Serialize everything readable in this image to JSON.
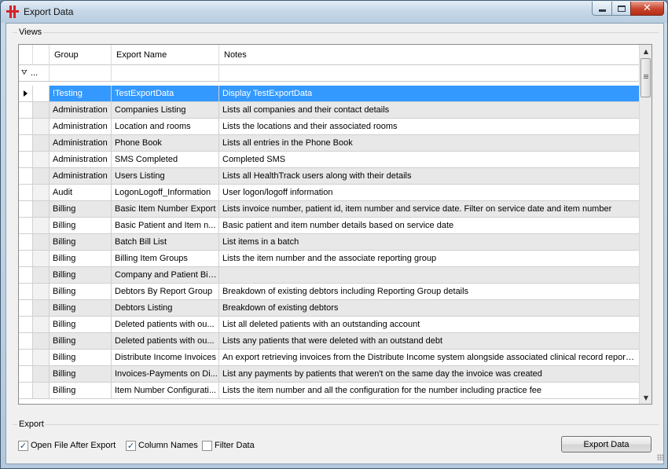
{
  "window": {
    "title": "Export Data",
    "close_glyph": "✕"
  },
  "views": {
    "label": "Views",
    "columns": {
      "group": "Group",
      "name": "Export Name",
      "notes": "Notes"
    },
    "filter_dots": "...",
    "filter_icon_glyph": "⛛",
    "scroll_up": "▲",
    "scroll_down": "▼",
    "rows": [
      {
        "group": "!Testing",
        "name": "TestExportData",
        "notes": "Display TestExportData",
        "selected": true
      },
      {
        "group": "Administration",
        "name": "Companies Listing",
        "notes": "Lists all companies and their contact details"
      },
      {
        "group": "Administration",
        "name": "Location and rooms",
        "notes": "Lists the locations and their associated rooms"
      },
      {
        "group": "Administration",
        "name": "Phone Book",
        "notes": "Lists all entries in the Phone Book"
      },
      {
        "group": "Administration",
        "name": "SMS Completed",
        "notes": "Completed SMS"
      },
      {
        "group": "Administration",
        "name": "Users Listing",
        "notes": "Lists all HealthTrack users along with their details"
      },
      {
        "group": "Audit",
        "name": "LogonLogoff_Information",
        "notes": "User logon/logoff information"
      },
      {
        "group": "Billing",
        "name": "Basic Item Number Export",
        "notes": "Lists invoice number, patient id, item number and service date. Filter on service date and item number"
      },
      {
        "group": "Billing",
        "name": "Basic Patient and Item n...",
        "notes": "Basic patient and item number details based on service date"
      },
      {
        "group": "Billing",
        "name": "Batch Bill List",
        "notes": "List items in a batch"
      },
      {
        "group": "Billing",
        "name": "Billing Item Groups",
        "notes": "Lists the item number and the associate reporting group"
      },
      {
        "group": "Billing",
        "name": "Company and Patient Billi...",
        "notes": ""
      },
      {
        "group": "Billing",
        "name": "Debtors By Report Group",
        "notes": "Breakdown of existing debtors including Reporting Group details"
      },
      {
        "group": "Billing",
        "name": "Debtors Listing",
        "notes": "Breakdown of existing debtors"
      },
      {
        "group": "Billing",
        "name": "Deleted patients with ou...",
        "notes": "List all deleted patients with an outstanding account"
      },
      {
        "group": "Billing",
        "name": "Deleted patients with ou...",
        "notes": "Lists any patients that were deleted with an outstand debt"
      },
      {
        "group": "Billing",
        "name": "Distribute Income Invoices",
        "notes": "An export retrieving invoices from the Distribute Income system alongside associated clinical record reporti..."
      },
      {
        "group": "Billing",
        "name": "Invoices-Payments on Di...",
        "notes": "List any payments by patients that weren't on the same day the invoice was created"
      },
      {
        "group": "Billing",
        "name": "Item Number Configurati...",
        "notes": "Lists the item number and all the configuration for the number including practice fee"
      }
    ]
  },
  "export": {
    "label": "Export",
    "check_glyph": "✓",
    "options": [
      {
        "label": "Open File After Export",
        "checked": true
      },
      {
        "label": "Column Names",
        "checked": true
      },
      {
        "label": "Filter Data",
        "checked": false
      }
    ],
    "button_label": "Export Data"
  }
}
